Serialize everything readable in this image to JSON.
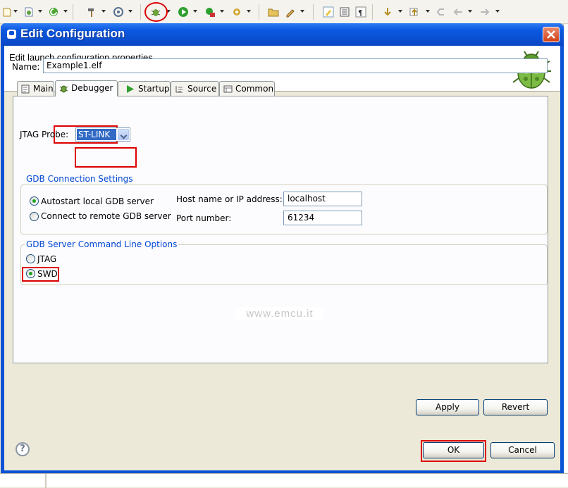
{
  "window": {
    "title": "Edit Configuration",
    "banner_text": "Edit launch configuration properties"
  },
  "config": {
    "name_label": "Name:",
    "name_value": "Example1.elf"
  },
  "tabs": [
    {
      "label": "Main",
      "icon": "main-tab-icon"
    },
    {
      "label": "Debugger",
      "icon": "bug-icon",
      "selected": true
    },
    {
      "label": "Startup",
      "icon": "play-icon"
    },
    {
      "label": "Source",
      "icon": "source-icon"
    },
    {
      "label": "Common",
      "icon": "common-icon"
    }
  ],
  "debugger": {
    "jtag_probe_label": "JTAG Probe:",
    "jtag_probe_value": "ST-LINK",
    "gdb_connection": {
      "title": "GDB Connection Settings",
      "autostart_label": "Autostart local GDB server",
      "remote_label": "Connect to remote GDB server",
      "selected": "autostart",
      "host_label": "Host name or IP address:",
      "host_value": "localhost",
      "port_label": "Port number:",
      "port_value": "61234"
    },
    "gdb_server_options": {
      "title": "GDB Server Command Line Options",
      "jtag_label": "JTAG",
      "swd_label": "SWD",
      "selected": "SWD"
    }
  },
  "watermark": "www.emcu.it",
  "buttons": {
    "apply": "Apply",
    "revert": "Revert",
    "ok": "OK",
    "cancel": "Cancel",
    "help": "?"
  },
  "colors": {
    "titlebar": "#0a4fd2",
    "highlight_box": "#dd0000",
    "group_title": "#0046d5",
    "selection": "#316ac5"
  }
}
